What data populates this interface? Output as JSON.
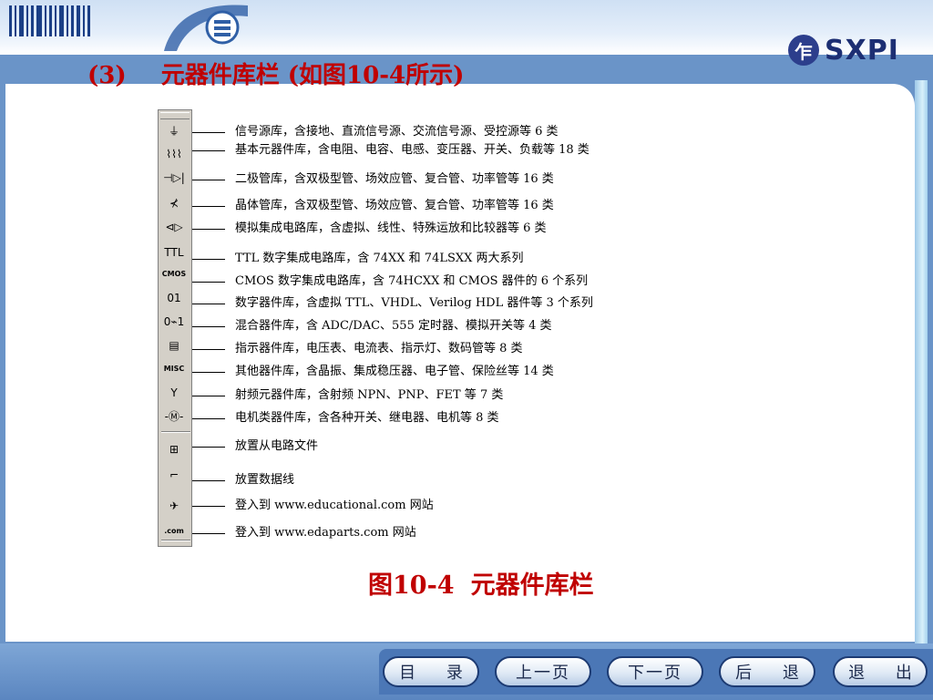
{
  "header": {
    "logo_text": "SXPI",
    "logo_badge_glyph": "乍",
    "swoosh_glyph": "目"
  },
  "slide": {
    "title_num": "(3)",
    "title_text": "元器件库栏 (如图10-4所示)"
  },
  "toolbar": {
    "items": [
      {
        "icon": "ground-source-icon",
        "glyph": "⏚",
        "label": "信号源库，含接地、直流信号源、交流信号源、受控源等 6 类"
      },
      {
        "icon": "resistor-icon",
        "glyph": "⌇⌇⌇",
        "label": "基本元器件库，含电阻、电容、电感、变压器、开关、负载等 18 类"
      },
      {
        "icon": "diode-icon",
        "glyph": "⊣▷|",
        "label": "二极管库，含双极型管、场效应管、复合管、功率管等 16 类"
      },
      {
        "icon": "transistor-icon",
        "glyph": "⊀",
        "label": "晶体管库，含双极型管、场效应管、复合管、功率管等 16 类"
      },
      {
        "icon": "opamp-icon",
        "glyph": "⊲▷",
        "label": "模拟集成电路库，含虚拟、线性、特殊运放和比较器等 6 类"
      },
      {
        "icon": "ttl-gate-icon",
        "glyph": "TTL",
        "label": "TTL 数字集成电路库，含 74XX 和 74LSXX 两大系列"
      },
      {
        "icon": "cmos-gate-icon",
        "glyph": "CMOS",
        "label": "CMOS 数字集成电路库，含 74HCXX 和 CMOS 器件的 6 个系列"
      },
      {
        "icon": "digital-device-icon",
        "glyph": "01",
        "label": "数字器件库，含虚拟 TTL、VHDL、Verilog HDL 器件等 3 个系列"
      },
      {
        "icon": "mixed-device-icon",
        "glyph": "0⌁1",
        "label": "混合器件库，含 ADC/DAC、555 定时器、模拟开关等 4 类"
      },
      {
        "icon": "indicator-icon",
        "glyph": "▤",
        "label": "指示器件库，电压表、电流表、指示灯、数码管等 8 类"
      },
      {
        "icon": "misc-icon",
        "glyph": "MISC",
        "label": "其他器件库，含晶振、集成稳压器、电子管、保险丝等 14 类"
      },
      {
        "icon": "antenna-icon",
        "glyph": "Y",
        "label": "射频元器件库，含射频 NPN、PNP、FET 等 7 类"
      },
      {
        "icon": "motor-icon",
        "glyph": "-Ⓜ-",
        "label": "电机类器件库，含各种开关、继电器、电机等 8 类"
      },
      {
        "icon": "place-subcircuit-icon",
        "glyph": "⊞",
        "label": "放置从电路文件"
      },
      {
        "icon": "place-bus-icon",
        "glyph": "⌐",
        "label": "放置数据线"
      },
      {
        "icon": "educational-web-icon",
        "glyph": "✈",
        "label": "登入到 www.educational.com 网站"
      },
      {
        "icon": "edaparts-web-icon",
        "glyph": ".com",
        "label": "登入到 www.edaparts.com 网站"
      }
    ]
  },
  "caption": {
    "num": "图10-4",
    "text": "元器件库栏"
  },
  "nav": {
    "contents": "目 录",
    "prev": "上一页",
    "next": "下一页",
    "back": "后 退",
    "exit": "退 出"
  },
  "colors": {
    "title_red": "#c00000",
    "frame_blue": "#6a94c8",
    "button_border": "#1d3b73"
  }
}
